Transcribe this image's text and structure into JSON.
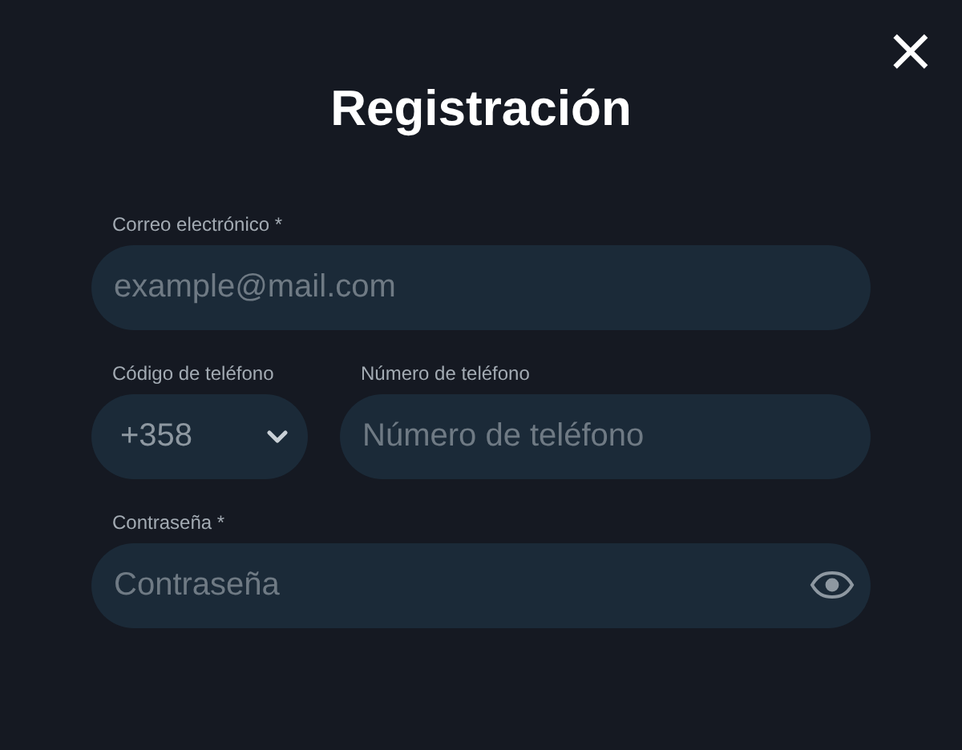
{
  "dialog": {
    "title": "Registración",
    "close": "×"
  },
  "email": {
    "label": "Correo electrónico *",
    "placeholder": "example@mail.com"
  },
  "phone_code": {
    "label": "Código de teléfono",
    "value": "+358"
  },
  "phone_number": {
    "label": "Número de teléfono",
    "placeholder": "Número de teléfono"
  },
  "password": {
    "label": "Contraseña *",
    "placeholder": "Contraseña"
  }
}
